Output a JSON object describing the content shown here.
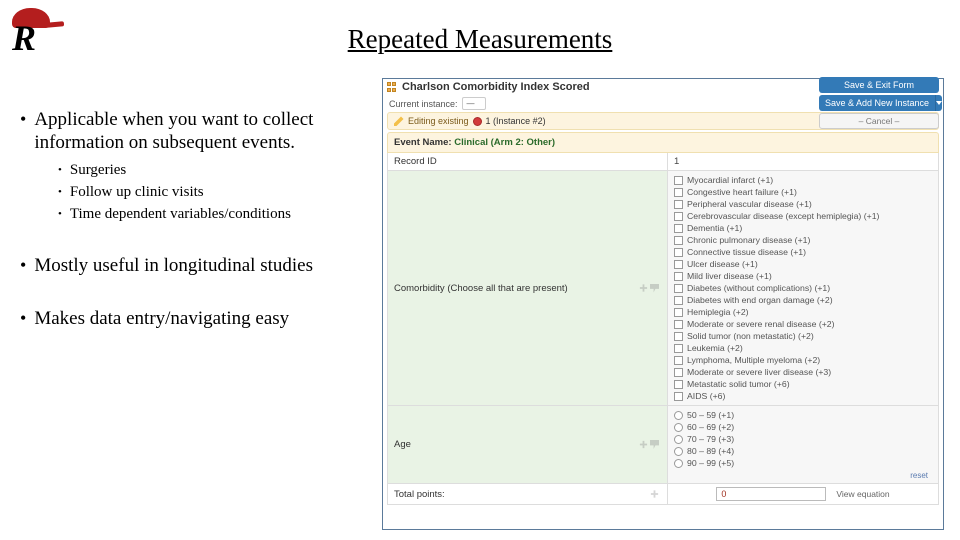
{
  "title": "Repeated Measurements",
  "bullets": {
    "b1": "Applicable when you want to collect information on subsequent events.",
    "b1_sub": [
      "Surgeries",
      "Follow up clinic visits",
      "Time dependent variables/conditions"
    ],
    "b2": "Mostly useful in longitudinal studies",
    "b3": "Makes data entry/navigating easy"
  },
  "form": {
    "title": "Charlson Comorbidity Index Scored",
    "instance_label": "Current instance:",
    "instance_display": "—",
    "save_exit": "Save & Exit Form",
    "save_add": "Save & Add New Instance",
    "cancel": "– Cancel –",
    "editing": "Editing existing",
    "instance_suffix": "1 (Instance #2)",
    "event_label": "Event Name:",
    "event_value": "Clinical (Arm 2: Other)",
    "record_id_label": "Record ID",
    "record_id_value": "1",
    "comorbidity_label": "Comorbidity (Choose all that are present)",
    "comorbidity_options": [
      "Myocardial infarct (+1)",
      "Congestive heart failure (+1)",
      "Peripheral vascular disease (+1)",
      "Cerebrovascular disease (except hemiplegia) (+1)",
      "Dementia (+1)",
      "Chronic pulmonary disease (+1)",
      "Connective tissue disease (+1)",
      "Ulcer disease (+1)",
      "Mild liver disease (+1)",
      "Diabetes (without complications) (+1)",
      "Diabetes with end organ damage (+2)",
      "Hemiplegia (+2)",
      "Moderate or severe renal disease (+2)",
      "Solid tumor (non metastatic) (+2)",
      "Leukemia (+2)",
      "Lymphoma, Multiple myeloma (+2)",
      "Moderate or severe liver disease (+3)",
      "Metastatic solid tumor (+6)",
      "AIDS (+6)"
    ],
    "age_label": "Age",
    "age_options": [
      "50 – 59 (+1)",
      "60 – 69 (+2)",
      "70 – 79 (+3)",
      "80 – 89 (+4)",
      "90 – 99 (+5)"
    ],
    "reset": "reset",
    "total_label": "Total points:",
    "total_value": "0",
    "view_eq": "View equation"
  }
}
